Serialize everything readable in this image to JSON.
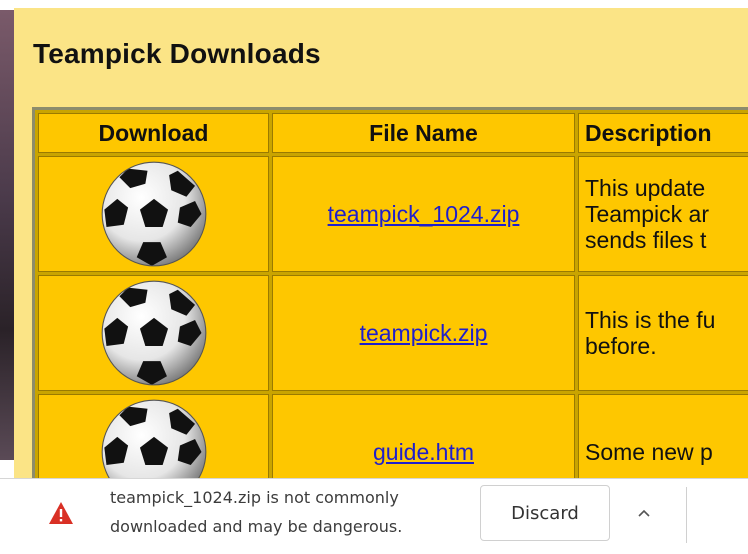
{
  "page": {
    "title": "Teampick Downloads"
  },
  "table": {
    "headers": [
      "Download",
      "File Name",
      "Description"
    ],
    "rows": [
      {
        "icon": "soccer-ball-icon",
        "file": "teampick_1024.zip",
        "description": [
          "This update",
          "Teampick ar",
          "sends files t"
        ]
      },
      {
        "icon": "soccer-ball-icon",
        "file": "teampick.zip",
        "description": [
          "This is the fu",
          "before."
        ]
      },
      {
        "icon": "soccer-ball-icon",
        "file": "guide.htm",
        "description": [
          "Some new p"
        ]
      }
    ]
  },
  "download_bar": {
    "icon": "warning-icon",
    "message_line1": "teampick_1024.zip is not commonly",
    "message_line2": "downloaded and may be dangerous.",
    "discard_label": "Discard",
    "expand_icon": "chevron-up-icon"
  },
  "colors": {
    "page_background": "#fbe486",
    "cell_background": "#fec700",
    "link": "#1f1fcc",
    "warning": "#d93025"
  }
}
